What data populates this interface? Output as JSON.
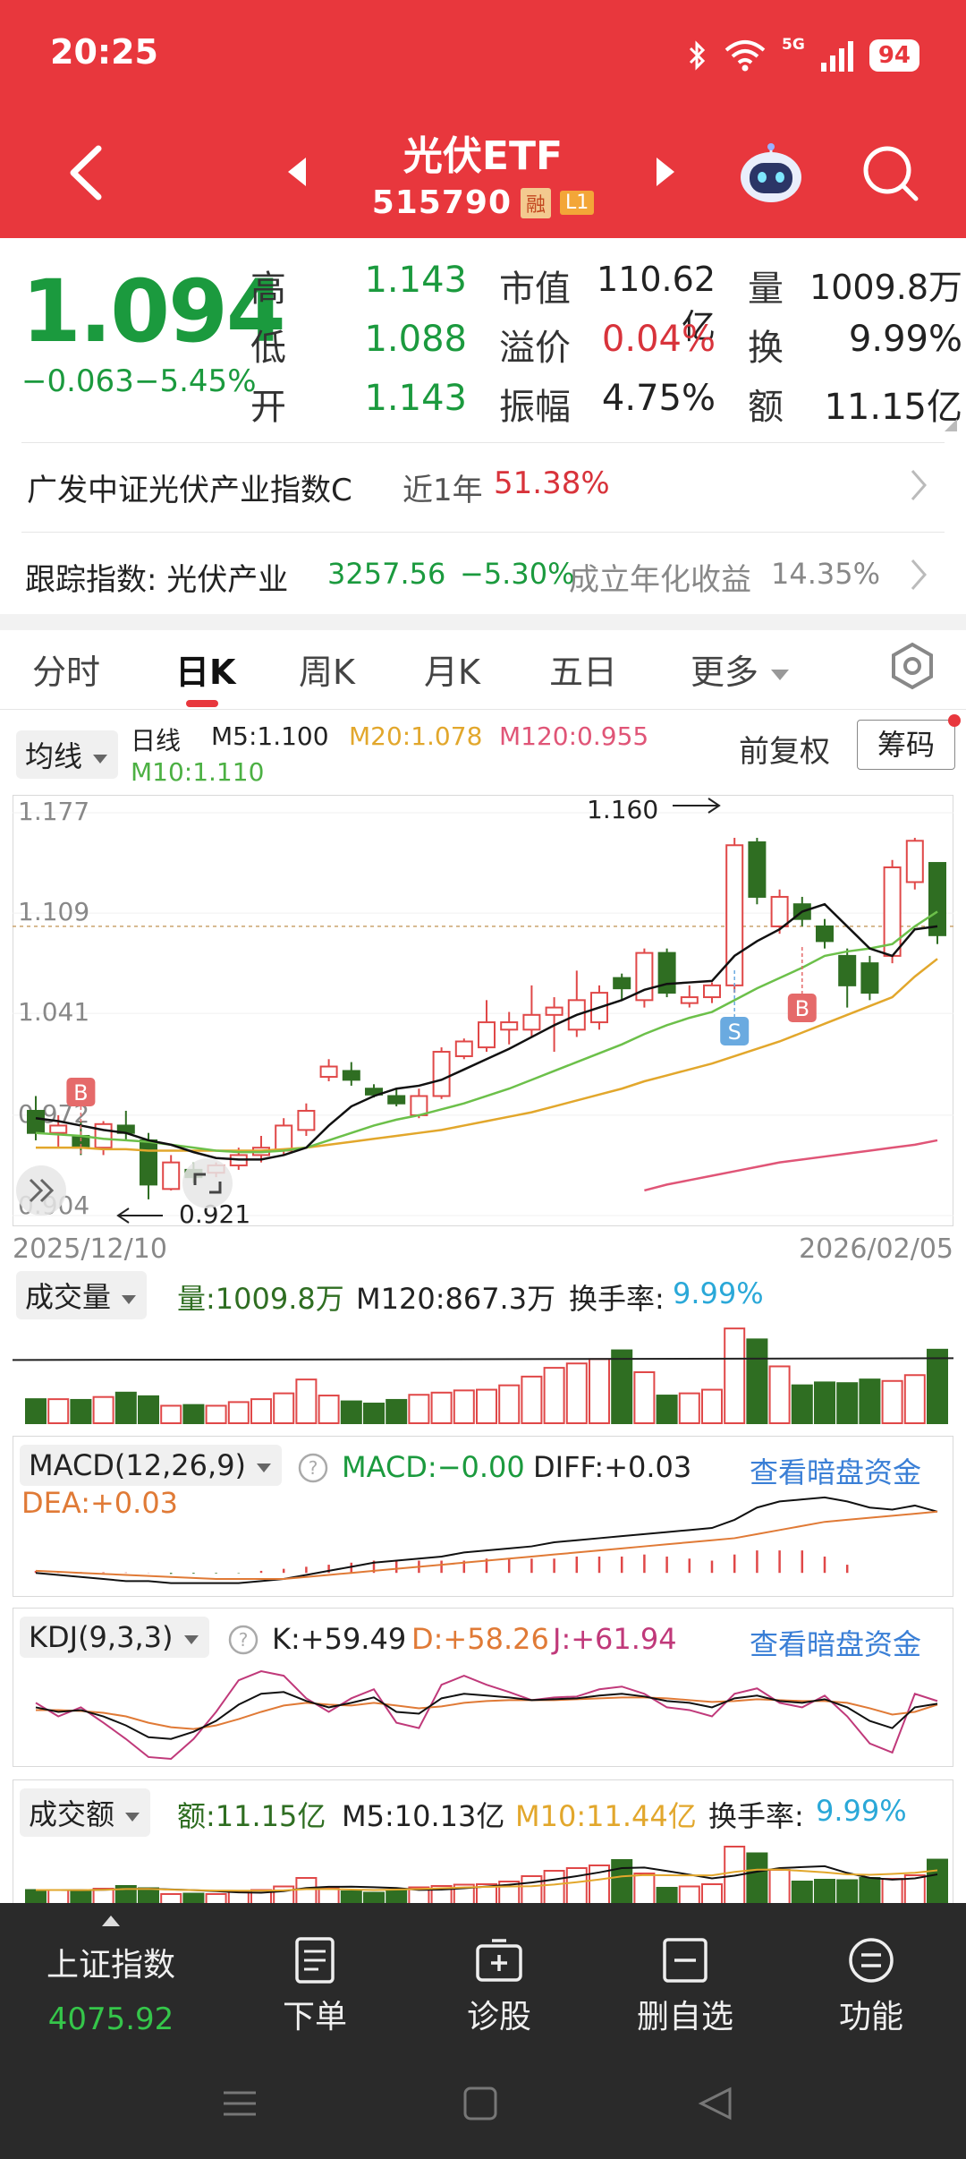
{
  "status": {
    "time": "20:25",
    "network": "5G",
    "battery": "94"
  },
  "header": {
    "title": "光伏ETF",
    "code": "515790",
    "tag_rong": "融",
    "tag_level": "L1"
  },
  "quote": {
    "price": "1.094",
    "change": "−0.063",
    "change_pct": "−5.45%",
    "high_label": "高",
    "high": "1.143",
    "low_label": "低",
    "low": "1.088",
    "open_label": "开",
    "open": "1.143",
    "mktcap_label": "市值",
    "mktcap": "110.62亿",
    "premium_label": "溢价",
    "premium": "0.04%",
    "amplitude_label": "振幅",
    "amplitude": "4.75%",
    "volume_label": "量",
    "volume": "1009.8万",
    "turnover_label": "换",
    "turnover": "9.99%",
    "amount_label": "额",
    "amount": "11.15亿"
  },
  "fund": {
    "name": "广发中证光伏产业指数C",
    "period": "近1年",
    "return": "51.38%"
  },
  "tracking": {
    "label": "跟踪指数: 光伏产业",
    "value": "3257.56",
    "change": "−5.30%",
    "annual_label": "成立年化收益",
    "annual": "14.35%"
  },
  "tabs": [
    "分时",
    "日K",
    "周K",
    "月K",
    "五日",
    "更多"
  ],
  "kline_header": {
    "ma_chip": "均线",
    "period": "日线",
    "m5": "M5:1.100",
    "m20": "M20:1.078",
    "m120": "M120:0.955",
    "m10": "M10:1.110",
    "adjust": "前复权",
    "chouma": "筹码"
  },
  "chart_data": {
    "type": "candlestick",
    "y_ticks": [
      "1.177",
      "1.109",
      "1.041",
      "0.972",
      "0.904"
    ],
    "ylim": [
      0.904,
      1.177
    ],
    "x_start": "2025/12/10",
    "x_end": "2026/02/05",
    "annotation_high": "1.160",
    "annotation_low": "0.921",
    "markers": [
      "B",
      "S",
      "B"
    ],
    "candles": [
      {
        "o": 0.975,
        "h": 0.985,
        "l": 0.955,
        "c": 0.96
      },
      {
        "o": 0.96,
        "h": 0.972,
        "l": 0.95,
        "c": 0.965
      },
      {
        "o": 0.958,
        "h": 0.968,
        "l": 0.945,
        "c": 0.95
      },
      {
        "o": 0.95,
        "h": 0.968,
        "l": 0.945,
        "c": 0.966
      },
      {
        "o": 0.965,
        "h": 0.975,
        "l": 0.955,
        "c": 0.96
      },
      {
        "o": 0.955,
        "h": 0.96,
        "l": 0.915,
        "c": 0.925
      },
      {
        "o": 0.922,
        "h": 0.945,
        "l": 0.921,
        "c": 0.94
      },
      {
        "o": 0.935,
        "h": 0.94,
        "l": 0.926,
        "c": 0.93
      },
      {
        "o": 0.933,
        "h": 0.94,
        "l": 0.93,
        "c": 0.938
      },
      {
        "o": 0.938,
        "h": 0.95,
        "l": 0.935,
        "c": 0.945
      },
      {
        "o": 0.945,
        "h": 0.958,
        "l": 0.94,
        "c": 0.95
      },
      {
        "o": 0.948,
        "h": 0.97,
        "l": 0.945,
        "c": 0.965
      },
      {
        "o": 0.962,
        "h": 0.98,
        "l": 0.958,
        "c": 0.975
      },
      {
        "o": 0.998,
        "h": 1.01,
        "l": 0.995,
        "c": 1.005
      },
      {
        "o": 1.002,
        "h": 1.008,
        "l": 0.992,
        "c": 0.996
      },
      {
        "o": 0.99,
        "h": 0.993,
        "l": 0.984,
        "c": 0.986
      },
      {
        "o": 0.985,
        "h": 0.99,
        "l": 0.978,
        "c": 0.98
      },
      {
        "o": 0.972,
        "h": 0.99,
        "l": 0.97,
        "c": 0.985
      },
      {
        "o": 0.985,
        "h": 1.018,
        "l": 0.983,
        "c": 1.015
      },
      {
        "o": 1.012,
        "h": 1.024,
        "l": 1.01,
        "c": 1.022
      },
      {
        "o": 1.018,
        "h": 1.05,
        "l": 1.015,
        "c": 1.035
      },
      {
        "o": 1.03,
        "h": 1.042,
        "l": 1.02,
        "c": 1.035
      },
      {
        "o": 1.03,
        "h": 1.06,
        "l": 1.025,
        "c": 1.04
      },
      {
        "o": 1.04,
        "h": 1.052,
        "l": 1.015,
        "c": 1.045
      },
      {
        "o": 1.03,
        "h": 1.07,
        "l": 1.025,
        "c": 1.05
      },
      {
        "o": 1.035,
        "h": 1.06,
        "l": 1.03,
        "c": 1.055
      },
      {
        "o": 1.065,
        "h": 1.068,
        "l": 1.05,
        "c": 1.058
      },
      {
        "o": 1.05,
        "h": 1.085,
        "l": 1.045,
        "c": 1.082
      },
      {
        "o": 1.082,
        "h": 1.085,
        "l": 1.052,
        "c": 1.055
      },
      {
        "o": 1.048,
        "h": 1.06,
        "l": 1.045,
        "c": 1.052
      },
      {
        "o": 1.052,
        "h": 1.062,
        "l": 1.048,
        "c": 1.06
      },
      {
        "o": 1.06,
        "h": 1.16,
        "l": 1.055,
        "c": 1.155
      },
      {
        "o": 1.157,
        "h": 1.16,
        "l": 1.115,
        "c": 1.12
      },
      {
        "o": 1.1,
        "h": 1.125,
        "l": 1.095,
        "c": 1.12
      },
      {
        "o": 1.115,
        "h": 1.12,
        "l": 1.1,
        "c": 1.105
      },
      {
        "o": 1.1,
        "h": 1.105,
        "l": 1.085,
        "c": 1.09
      },
      {
        "o": 1.08,
        "h": 1.085,
        "l": 1.045,
        "c": 1.06
      },
      {
        "o": 1.075,
        "h": 1.08,
        "l": 1.05,
        "c": 1.055
      },
      {
        "o": 1.08,
        "h": 1.145,
        "l": 1.075,
        "c": 1.14
      },
      {
        "o": 1.13,
        "h": 1.16,
        "l": 1.125,
        "c": 1.158
      },
      {
        "o": 1.143,
        "h": 1.143,
        "l": 1.088,
        "c": 1.094
      }
    ],
    "m5": [
      0.97,
      0.968,
      0.965,
      0.962,
      0.96,
      0.955,
      0.952,
      0.947,
      0.943,
      0.942,
      0.942,
      0.945,
      0.95,
      0.965,
      0.978,
      0.985,
      0.99,
      0.992,
      0.996,
      1.003,
      1.01,
      1.017,
      1.025,
      1.033,
      1.04,
      1.045,
      1.05,
      1.057,
      1.061,
      1.062,
      1.063,
      1.08,
      1.09,
      1.098,
      1.11,
      1.115,
      1.1,
      1.085,
      1.08,
      1.098,
      1.1
    ],
    "m10": [
      0.96,
      0.959,
      0.958,
      0.956,
      0.955,
      0.954,
      0.952,
      0.95,
      0.948,
      0.947,
      0.947,
      0.948,
      0.95,
      0.955,
      0.96,
      0.965,
      0.969,
      0.972,
      0.976,
      0.98,
      0.985,
      0.99,
      0.996,
      1.002,
      1.008,
      1.014,
      1.02,
      1.027,
      1.033,
      1.038,
      1.042,
      1.05,
      1.058,
      1.065,
      1.072,
      1.08,
      1.083,
      1.085,
      1.088,
      1.1,
      1.11
    ],
    "m20": [
      0.95,
      0.95,
      0.95,
      0.949,
      0.949,
      0.948,
      0.948,
      0.948,
      0.948,
      0.948,
      0.948,
      0.949,
      0.95,
      0.952,
      0.954,
      0.956,
      0.958,
      0.96,
      0.962,
      0.965,
      0.968,
      0.971,
      0.974,
      0.978,
      0.982,
      0.986,
      0.99,
      0.995,
      0.999,
      1.003,
      1.007,
      1.012,
      1.017,
      1.022,
      1.028,
      1.034,
      1.04,
      1.046,
      1.052,
      1.066,
      1.078
    ],
    "m120_start_index": 27,
    "m120": [
      0.921,
      0.925,
      0.928,
      0.931,
      0.934,
      0.937,
      0.94,
      0.942,
      0.944,
      0.946,
      0.948,
      0.95,
      0.952,
      0.955
    ],
    "volume": {
      "label": "成交量",
      "value": "量:1009.8万",
      "m120": "M120:867.3万",
      "turnover_label": "换手率:",
      "turnover": "9.99%",
      "vmax": 1400,
      "m120_value": 867,
      "bars": [
        330,
        330,
        320,
        360,
        420,
        370,
        240,
        250,
        240,
        290,
        330,
        410,
        600,
        380,
        300,
        270,
        320,
        390,
        420,
        450,
        460,
        520,
        640,
        760,
        820,
        880,
        1000,
        700,
        380,
        410,
        460,
        1300,
        1150,
        780,
        520,
        560,
        550,
        600,
        580,
        660,
        1009
      ]
    },
    "macd": {
      "label": "MACD(12,26,9)",
      "macd": "MACD:−0.00",
      "diff": "DIFF:+0.03",
      "dea": "DEA:+0.03",
      "link": "查看暗盘资金",
      "range": [
        -0.01,
        0.04
      ],
      "hist": [
        0.001,
        0.0005,
        0.0004,
        0.0003,
        0.0002,
        0.0001,
        -0.0005,
        -0.0004,
        -0.0003,
        -0.0002,
        0.001,
        0.002,
        0.003,
        0.004,
        0.005,
        0.006,
        0.006,
        0.006,
        0.006,
        0.006,
        0.007,
        0.007,
        0.007,
        0.007,
        0.008,
        0.008,
        0.008,
        0.009,
        0.008,
        0.007,
        0.006,
        0.009,
        0.011,
        0.011,
        0.011,
        0.008,
        0.004
      ],
      "diff_series": [
        0.0,
        -0.001,
        -0.002,
        -0.003,
        -0.004,
        -0.004,
        -0.005,
        -0.005,
        -0.005,
        -0.005,
        -0.004,
        -0.003,
        -0.001,
        0.001,
        0.003,
        0.005,
        0.006,
        0.007,
        0.008,
        0.01,
        0.011,
        0.012,
        0.013,
        0.015,
        0.016,
        0.017,
        0.018,
        0.019,
        0.02,
        0.021,
        0.022,
        0.026,
        0.032,
        0.035,
        0.036,
        0.037,
        0.035,
        0.032,
        0.031,
        0.033,
        0.03
      ],
      "dea_series": [
        0.001,
        0.0005,
        0.0,
        -0.0005,
        -0.001,
        -0.0015,
        -0.002,
        -0.0025,
        -0.003,
        -0.003,
        -0.003,
        -0.003,
        -0.002,
        -0.001,
        0.0,
        0.001,
        0.002,
        0.003,
        0.004,
        0.005,
        0.006,
        0.007,
        0.008,
        0.009,
        0.01,
        0.011,
        0.012,
        0.013,
        0.014,
        0.015,
        0.016,
        0.017,
        0.019,
        0.021,
        0.023,
        0.025,
        0.026,
        0.027,
        0.028,
        0.029,
        0.03
      ]
    },
    "kdj": {
      "label": "KDJ(9,3,3)",
      "k": "K:+59.49",
      "d": "D:+58.26",
      "j": "J:+61.94",
      "link": "查看暗盘资金",
      "k_series": [
        55,
        50,
        52,
        45,
        35,
        22,
        20,
        28,
        40,
        58,
        70,
        72,
        62,
        55,
        60,
        66,
        50,
        48,
        65,
        70,
        68,
        66,
        63,
        64,
        65,
        68,
        70,
        67,
        62,
        60,
        55,
        65,
        68,
        62,
        60,
        64,
        55,
        40,
        32,
        55,
        59
      ],
      "d_series": [
        52,
        52,
        51,
        49,
        45,
        38,
        33,
        31,
        35,
        42,
        50,
        57,
        60,
        58,
        57,
        60,
        57,
        54,
        56,
        60,
        62,
        63,
        63,
        63,
        64,
        65,
        66,
        66,
        65,
        63,
        61,
        62,
        64,
        63,
        62,
        62,
        60,
        54,
        47,
        50,
        58
      ],
      "j_series": [
        60,
        45,
        55,
        38,
        20,
        0,
        -2,
        20,
        50,
        85,
        95,
        90,
        65,
        50,
        65,
        75,
        38,
        32,
        80,
        90,
        80,
        72,
        63,
        66,
        67,
        75,
        78,
        70,
        55,
        52,
        45,
        70,
        76,
        60,
        55,
        68,
        45,
        15,
        5,
        70,
        62
      ]
    },
    "amount": {
      "label": "成交额",
      "value": "额:11.15亿",
      "m5": "M5:10.13亿",
      "m10": "M10:11.44亿",
      "turnover_label": "换手率:",
      "turnover": "9.99%"
    }
  },
  "bottom": {
    "index_name": "上证指数",
    "index_value": "4075.92",
    "items": [
      "下单",
      "诊股",
      "删自选",
      "功能"
    ]
  },
  "colors": {
    "up": "#e04848",
    "down": "#2f6e22",
    "brand": "#e8373d",
    "m5": "#111111",
    "m10": "#6cc04a",
    "m20": "#e2a72c",
    "m120": "#e05577"
  }
}
